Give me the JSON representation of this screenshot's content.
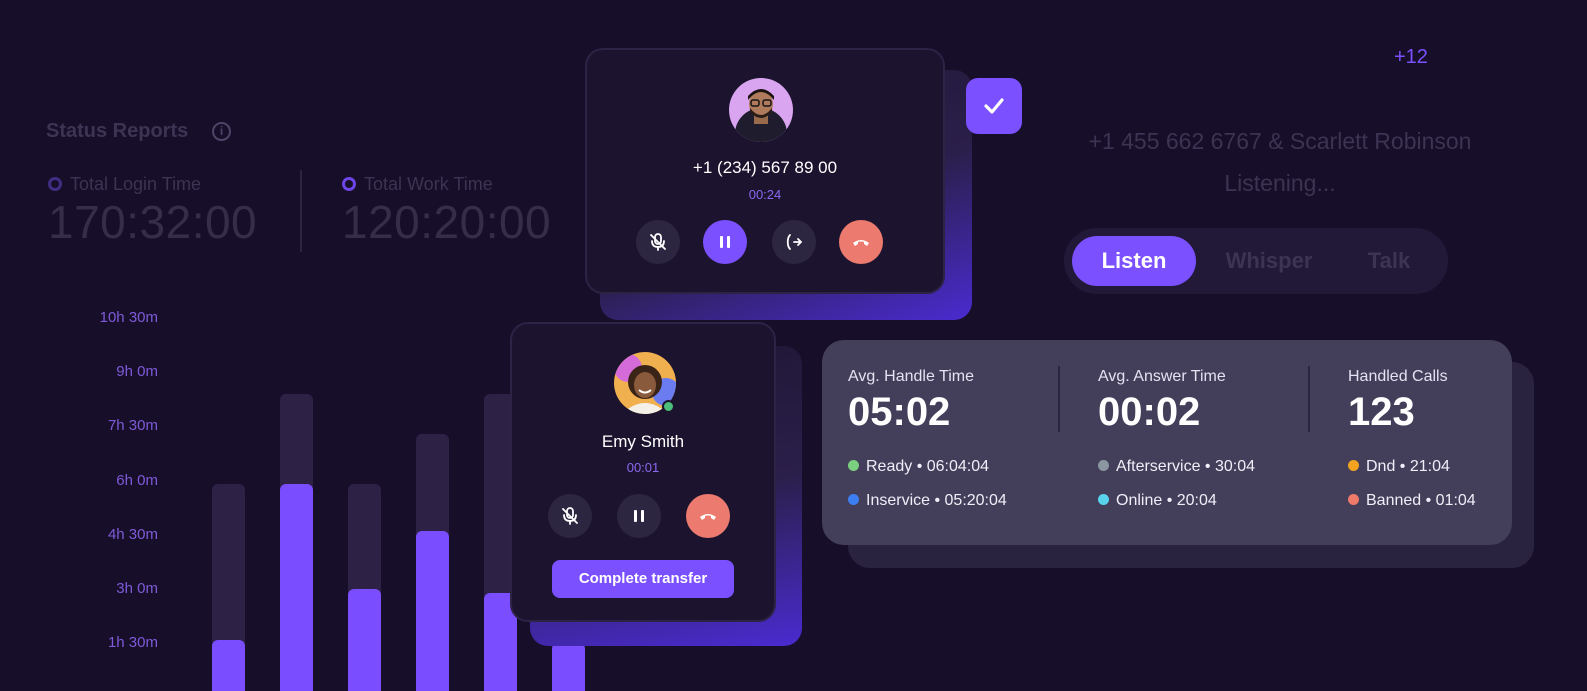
{
  "status_reports": {
    "title": "Status Reports",
    "info_icon": "info-icon",
    "metrics": [
      {
        "label": "Total Login Time",
        "value": "170:32:00",
        "dot_color": "#3e2f85"
      },
      {
        "label": "Total Work Time",
        "value": "120:20:00",
        "dot_color": "#6d45e8"
      }
    ]
  },
  "chart_data": {
    "type": "bar",
    "y_tick_labels": [
      "10h 30m",
      "9h 0m",
      "7h 30m",
      "6h 0m",
      "4h 30m",
      "3h 0m",
      "1h 30m"
    ],
    "series": [
      {
        "values_hours": [
          1.6,
          5.9,
          3.0,
          4.6,
          2.9,
          1.5
        ]
      },
      {
        "values_hours": [
          5.9,
          8.4,
          5.9,
          7.3,
          8.4,
          6.0
        ]
      }
    ],
    "colors": {
      "fill": "#7a4dff",
      "track": "#2d2146"
    }
  },
  "call_primary": {
    "phone": "+1 (234) 567 89 00",
    "timer": "00:24",
    "controls": [
      "mute-icon",
      "pause-icon",
      "transfer-icon",
      "hangup-icon"
    ]
  },
  "confirm_icon": "check-icon",
  "call_transfer": {
    "name": "Emy Smith",
    "timer": "00:01",
    "controls": [
      "mute-icon",
      "pause-icon",
      "hangup-icon"
    ],
    "complete_label": "Complete transfer",
    "presence_color": "#4cc07a"
  },
  "monitor": {
    "extra_count": "+12",
    "caller": "+1 455 662 6767 & Scarlett Robinson",
    "state": "Listening...",
    "modes": [
      "Listen",
      "Whisper",
      "Talk"
    ],
    "active_mode": "Listen"
  },
  "stats": {
    "metrics": [
      {
        "label": "Avg. Handle Time",
        "value": "05:02"
      },
      {
        "label": "Avg. Answer Time",
        "value": "00:02"
      },
      {
        "label": "Handled Calls",
        "value": "123"
      }
    ],
    "statuses": [
      {
        "text": "Ready • 06:04:04",
        "color": "#7bd07f"
      },
      {
        "text": "Afterservice • 30:04",
        "color": "#8a96a0"
      },
      {
        "text": "Dnd • 21:04",
        "color": "#f2a320"
      },
      {
        "text": "Inservice • 05:20:04",
        "color": "#3d7ff2"
      },
      {
        "text": "Online • 20:04",
        "color": "#59d2ec"
      },
      {
        "text": "Banned • 01:04",
        "color": "#ee7a6a"
      }
    ]
  },
  "colors": {
    "accent": "#7b50ff",
    "background": "#170f2a",
    "danger": "#ec7a6e"
  }
}
